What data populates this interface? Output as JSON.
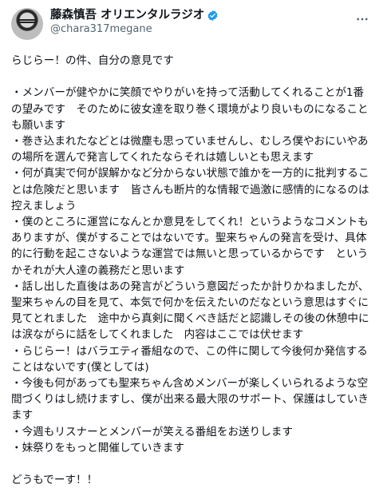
{
  "tweet": {
    "display_name": "藤森慎吾 オリエンタルラジオ",
    "handle": "@chara317megane",
    "more_icon": "more-horizontal-icon",
    "verified_icon": "verified-badge-icon",
    "accent_color": "#1d9bf0",
    "text": "らじらー！の件、自分の意見です\n\n・メンバーが健やかに笑顔でやりがいを持って活動してくれることが1番の望みです　そのために彼女達を取り巻く環境がより良いものになることも願います\n・巻き込まれたなどとは微塵も思っていませんし、むしろ僕やおにいやあの場所を選んで発言してくれたならそれは嬉しいとも思えます\n・何が真実で何が誤解かなど分からない状態で誰かを一方的に批判することは危険だと思います　皆さんも断片的な情報で過激に感情的になるのは控えましょう\n・僕のところに運営になんとか意見をしてくれ！というようなコメントもありますが、僕がすることではないです。聖来ちゃんの発言を受け、具体的に行動を起こさないような運営では無いと思っているからです　というかそれが大人達の義務だと思います\n・話し出した直後はあの発言がどういう意図だったか計りかねましたが、聖来ちゃんの目を見て、本気で何かを伝えたいのだなという意思はすぐに見てとれました　途中から真剣に聞くべき話だと認識しその後の休憩中には涙ながらに話をしてくれました　内容はここでは伏せます\n・らじらー！はバラエティ番組なので、この件に関して今後何か発信することはないです(僕としては)\n・今後も何があっても聖来ちゃん含めメンバーが楽しくいられるような空間づくりはし続けますし、僕が出来る最大限のサポート、保護はしていきます\n・今週もリスナーとメンバーが笑える番組をお送りします\n・妹祭りをもっと開催していきます\n\nどうもでーす！！"
  }
}
